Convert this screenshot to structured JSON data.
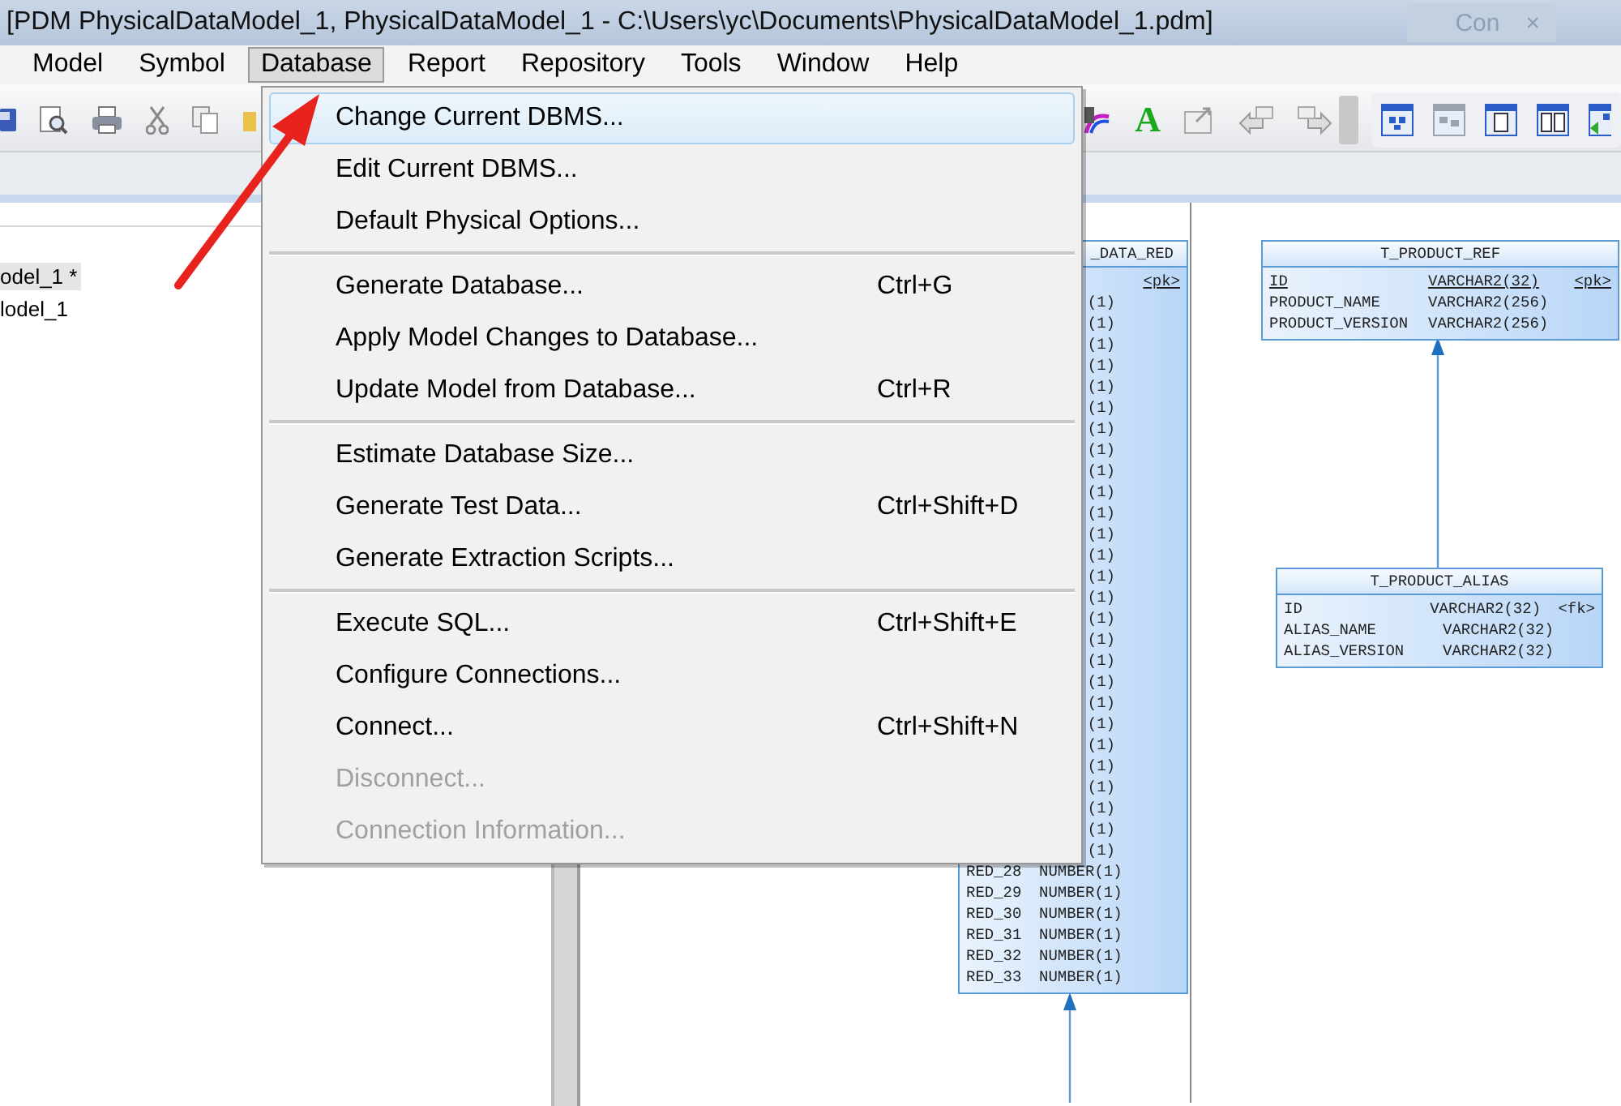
{
  "window": {
    "title": "[PDM PhysicalDataModel_1, PhysicalDataModel_1 - C:\\Users\\yc\\Documents\\PhysicalDataModel_1.pdm]",
    "background_tab": {
      "label": "Con",
      "close": "×"
    }
  },
  "menu_bar": [
    {
      "label": "Model",
      "selected": false
    },
    {
      "label": "Symbol",
      "selected": false
    },
    {
      "label": "Database",
      "selected": true
    },
    {
      "label": "Report",
      "selected": false
    },
    {
      "label": "Repository",
      "selected": false
    },
    {
      "label": "Tools",
      "selected": false
    },
    {
      "label": "Window",
      "selected": false
    },
    {
      "label": "Help",
      "selected": false
    }
  ],
  "toolbar": {
    "text_tool": "A"
  },
  "model_tree": {
    "items": [
      {
        "label": "odel_1 *",
        "selected": true
      },
      {
        "label": "lodel_1",
        "selected": false
      }
    ]
  },
  "database_menu": {
    "items": [
      {
        "kind": "item",
        "label": "Change Current DBMS...",
        "selected": true,
        "disabled": false
      },
      {
        "kind": "item",
        "label": "Edit Current DBMS...",
        "selected": false,
        "disabled": false
      },
      {
        "kind": "item",
        "label": "Default Physical Options...",
        "selected": false,
        "disabled": false
      },
      {
        "kind": "separator"
      },
      {
        "kind": "item",
        "label": "Generate Database...",
        "shortcut": "Ctrl+G",
        "selected": false,
        "disabled": false
      },
      {
        "kind": "item",
        "label": "Apply Model Changes to Database...",
        "selected": false,
        "disabled": false
      },
      {
        "kind": "item",
        "label": "Update Model from Database...",
        "shortcut": "Ctrl+R",
        "selected": false,
        "disabled": false
      },
      {
        "kind": "separator"
      },
      {
        "kind": "item",
        "label": "Estimate Database Size...",
        "selected": false,
        "disabled": false
      },
      {
        "kind": "item",
        "label": "Generate Test Data...",
        "shortcut": "Ctrl+Shift+D",
        "selected": false,
        "disabled": false
      },
      {
        "kind": "item",
        "label": "Generate Extraction Scripts...",
        "selected": false,
        "disabled": false
      },
      {
        "kind": "separator"
      },
      {
        "kind": "item",
        "label": "Execute SQL...",
        "shortcut": "Ctrl+Shift+E",
        "selected": false,
        "disabled": false
      },
      {
        "kind": "item",
        "label": "Configure Connections...",
        "selected": false,
        "disabled": false
      },
      {
        "kind": "item",
        "label": "Connect...",
        "shortcut": "Ctrl+Shift+N",
        "selected": false,
        "disabled": false
      },
      {
        "kind": "item",
        "label": "Disconnect...",
        "selected": false,
        "disabled": true
      },
      {
        "kind": "item",
        "label": "Connection Information...",
        "selected": false,
        "disabled": true
      }
    ]
  },
  "diagram": {
    "tables": [
      {
        "kind": "cut",
        "title": "_DATA_RED",
        "rows": [
          {
            "column_3": "<pk>",
            "primary_key": true
          },
          {
            "column_2": "(1)",
            "primary_key": false
          },
          {
            "column_2": "(1)",
            "primary_key": false
          },
          {
            "column_2": "(1)",
            "primary_key": false
          },
          {
            "column_2": "(1)",
            "primary_key": false
          },
          {
            "column_2": "(1)",
            "primary_key": false
          },
          {
            "column_2": "(1)",
            "primary_key": false
          },
          {
            "column_2": "(1)",
            "primary_key": false
          },
          {
            "column_2": "(1)",
            "primary_key": false
          },
          {
            "column_2": "(1)",
            "primary_key": false
          },
          {
            "column_2": "(1)",
            "primary_key": false
          },
          {
            "column_2": "(1)",
            "primary_key": false
          },
          {
            "column_2": "(1)",
            "primary_key": false
          },
          {
            "column_2": "(1)",
            "primary_key": false
          },
          {
            "column_2": "(1)",
            "primary_key": false
          },
          {
            "column_2": "(1)",
            "primary_key": false
          },
          {
            "column_2": "(1)",
            "primary_key": false
          },
          {
            "column_2": "(1)",
            "primary_key": false
          },
          {
            "column_2": "(1)",
            "primary_key": false
          },
          {
            "column_2": "(1)",
            "primary_key": false
          },
          {
            "column_2": "(1)",
            "primary_key": false
          },
          {
            "column_2": "(1)",
            "primary_key": false
          },
          {
            "column_2": "(1)",
            "primary_key": false
          },
          {
            "column_2": "(1)",
            "primary_key": false
          },
          {
            "column_2": "(1)",
            "primary_key": false
          },
          {
            "column_2": "(1)",
            "primary_key": false
          },
          {
            "column_2": "(1)",
            "primary_key": false
          },
          {
            "column_2": "(1)",
            "primary_key": false
          },
          {
            "column_1": "RED_28",
            "column_2": "NUMBER(1)",
            "primary_key": false
          },
          {
            "column_1": "RED_29",
            "column_2": "NUMBER(1)",
            "primary_key": false
          },
          {
            "column_1": "RED_30",
            "column_2": "NUMBER(1)",
            "primary_key": false
          },
          {
            "column_1": "RED_31",
            "column_2": "NUMBER(1)",
            "primary_key": false
          },
          {
            "column_1": "RED_32",
            "column_2": "NUMBER(1)",
            "primary_key": false
          },
          {
            "column_1": "RED_33",
            "column_2": "NUMBER(1)",
            "primary_key": false
          }
        ]
      },
      {
        "kind": "full",
        "title": "T_PRODUCT_REF",
        "rows": [
          {
            "column_1": "ID",
            "column_2": "VARCHAR2(32)",
            "column_3": "<pk>",
            "primary_key": true
          },
          {
            "column_1": "PRODUCT_NAME",
            "column_2": "VARCHAR2(256)",
            "primary_key": false
          },
          {
            "column_1": "PRODUCT_VERSION",
            "column_2": "VARCHAR2(256)",
            "primary_key": false
          }
        ]
      },
      {
        "kind": "full",
        "title": "T_PRODUCT_ALIAS",
        "rows": [
          {
            "column_1": "ID",
            "column_2": "VARCHAR2(32)",
            "column_3": "<fk>",
            "primary_key": false
          },
          {
            "column_1": "ALIAS_NAME",
            "column_2": "VARCHAR2(32)",
            "primary_key": false
          },
          {
            "column_1": "ALIAS_VERSION",
            "column_2": "VARCHAR2(32)",
            "primary_key": false
          }
        ]
      }
    ]
  }
}
